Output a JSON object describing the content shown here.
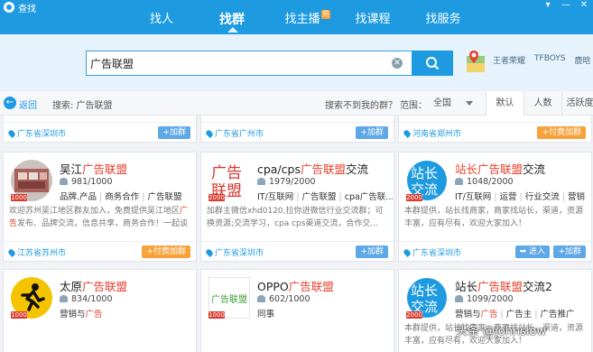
{
  "app": {
    "title": "查找",
    "controls": [
      "▾",
      "—",
      "✕"
    ]
  },
  "nav": {
    "items": [
      {
        "label": "找人",
        "active": false
      },
      {
        "label": "找群",
        "active": true
      },
      {
        "label": "找主播",
        "active": false,
        "badge": "热"
      },
      {
        "label": "找课程",
        "active": false
      },
      {
        "label": "找服务",
        "active": false
      }
    ]
  },
  "search": {
    "value": "广告联盟",
    "clear_glyph": "✕",
    "hot_words": [
      "王者荣耀",
      "TFBOYS",
      "鹿晗"
    ]
  },
  "filter": {
    "back_label": "返回",
    "breadcrumb": "搜索: 广告联盟",
    "not_found": "搜索不到我的群？",
    "range_label": "范围：",
    "range_value": "全国",
    "sort_tabs": [
      "默认",
      "人数",
      "活跃度"
    ]
  },
  "top_row": [
    {
      "location": "广东省深圳市",
      "button": "+加群"
    },
    {
      "location": "广东省广州市",
      "button": "+加群"
    },
    {
      "location": "河南省郑州市",
      "button": "+付费加群"
    }
  ],
  "groups": [
    {
      "name_prefix": "吴江",
      "name_highlight": "广告联盟",
      "name_suffix": "",
      "count": "981/1000",
      "tags": [
        "品牌.产品",
        "商务合作",
        "广告联盟"
      ],
      "desc_prefix": "欢迎苏州吴江地区群友加入，免费提供吴江地区",
      "desc_highlight": "广告",
      "desc_suffix": "发布、品牌交流，信息共享，商务合作！一起谈天...",
      "location": "江苏省苏州市",
      "button": "+付费加群",
      "level": "1000"
    },
    {
      "name_prefix": "cpa/cps",
      "name_highlight": "广告联盟",
      "name_suffix": "交流",
      "count": "1979/2000",
      "tags": [
        "IT/互联网",
        "广告联盟",
        "cpa广告联..."
      ],
      "desc_prefix": "加群主微信xhd0120,拉你进微信行业交流群；可换资源;交流学习，cpa cps渠道交流，合作交...",
      "desc_highlight": "",
      "desc_suffix": "",
      "location": "广东省深圳市",
      "button": "+加群",
      "level": "2000",
      "avatar_text": "广告联盟"
    },
    {
      "name_prefix": "",
      "name_highlight": "站长广告联盟",
      "name_suffix": "交流",
      "count": "1048/2000",
      "tags": [
        "IT/互联网",
        "运营",
        "行业交流",
        "营销"
      ],
      "desc_prefix": "本群提供，站长找商家，商家找站长，渠道，资源丰富，应有尽有，欢迎大家加入！",
      "desc_highlight": "",
      "desc_suffix": "",
      "location": "广东省深圳市",
      "button": "+加群",
      "button2": "➡ 进入",
      "level": "2000",
      "avatar_text": "站长交流"
    },
    {
      "name_prefix": "太原",
      "name_highlight": "广告联盟",
      "name_suffix": "",
      "count": "834/1000",
      "tags": [
        "营销与广告"
      ],
      "desc_prefix": "",
      "desc_highlight": "",
      "desc_suffix": "",
      "location": "",
      "button": "",
      "level": "1000"
    },
    {
      "name_prefix": "OPPO",
      "name_highlight": "广告联盟",
      "name_suffix": "",
      "count": "602/1000",
      "tags": [
        "同事"
      ],
      "desc_prefix": "",
      "desc_highlight": "",
      "desc_suffix": "",
      "location": "",
      "button": "",
      "level": "1000",
      "avatar_text": "广告联盟"
    },
    {
      "name_prefix": "站长",
      "name_highlight": "广告联盟",
      "name_suffix": "交流2",
      "count": "1099/2000",
      "tags": [
        "营销与广告",
        "广告主",
        "广告推广"
      ],
      "desc_prefix": "本群提供，站长找商家，商家找站长，渠道，资源丰富，应有尽有，欢迎大家加入！",
      "desc_highlight": "",
      "desc_suffix": "",
      "location": "",
      "button": "",
      "level": "2000",
      "avatar_text": "站长交流"
    }
  ],
  "watermark": "头条 @johnslow",
  "colors": {
    "brand": "#1e9be0",
    "highlight": "#e8402c",
    "paid": "#f7a23b"
  }
}
